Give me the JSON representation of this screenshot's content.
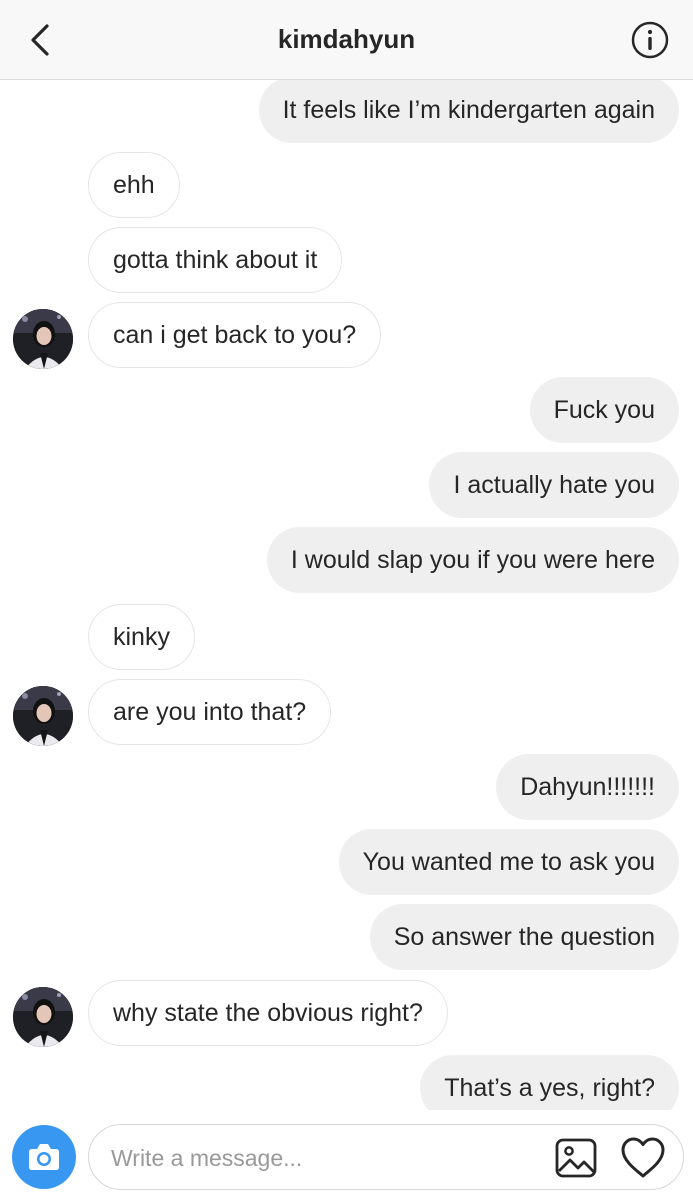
{
  "header": {
    "title": "kimdahyun",
    "back_icon": "chevron-left-icon",
    "info_icon": "info-circle-icon"
  },
  "messages": [
    {
      "sender": "me",
      "text": "It feels like I’m kindergarten again"
    },
    {
      "sender": "them",
      "text": "ehh"
    },
    {
      "sender": "them",
      "text": "gotta think about it"
    },
    {
      "sender": "them",
      "text": "can i get back to you?",
      "avatar": true
    },
    {
      "sender": "me",
      "text": "Fuck you"
    },
    {
      "sender": "me",
      "text": "I actually hate you"
    },
    {
      "sender": "me",
      "text": "I would slap you if you were here"
    },
    {
      "sender": "them",
      "text": "kinky"
    },
    {
      "sender": "them",
      "text": "are you into that?",
      "avatar": true
    },
    {
      "sender": "me",
      "text": "Dahyun!!!!!!!"
    },
    {
      "sender": "me",
      "text": "You wanted me to ask you"
    },
    {
      "sender": "me",
      "text": "So answer the question"
    },
    {
      "sender": "them",
      "text": "why state the obvious right?",
      "avatar": true
    },
    {
      "sender": "me",
      "text": "That’s a yes, right?"
    }
  ],
  "composer": {
    "placeholder": "Write a message...",
    "value": "",
    "camera_icon": "camera-icon",
    "gallery_icon": "image-gallery-icon",
    "like_icon": "heart-icon"
  },
  "colors": {
    "accent": "#3897f0",
    "outgoing_bubble": "#efeff0",
    "incoming_border": "#e6e6e6",
    "text": "#262626"
  }
}
